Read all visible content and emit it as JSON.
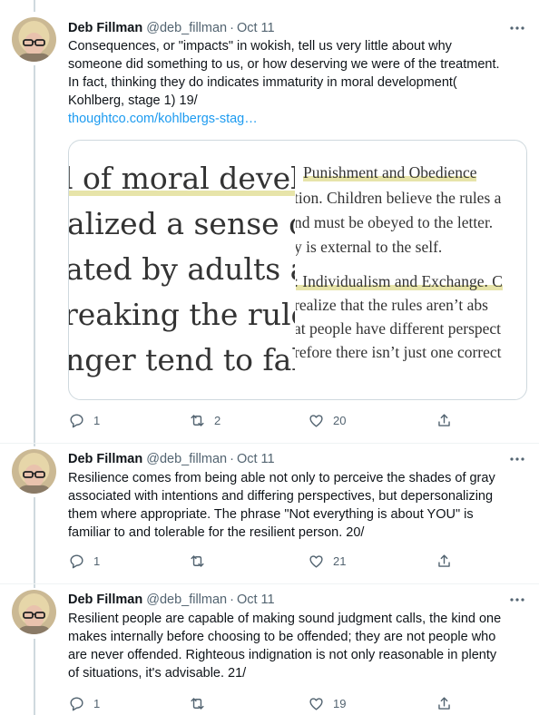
{
  "tweets": [
    {
      "author": {
        "name": "Deb Fillman",
        "handle": "@deb_fillman",
        "time": "Oct 11"
      },
      "lines": [
        "Consequences, or \"impacts\" in wokish, tell us very little about why",
        "someone did something to us, or how deserving we were of the treatment.",
        "In fact, thinking they do indicates immaturity in moral development(",
        "Kohlberg, stage 1) 19/"
      ],
      "link": "thoughtco.com/kohlbergs-stag…",
      "media": {
        "left_lines": [
          "l of moral develop",
          "alized a sense of ri",
          "ated by adults an",
          "reaking the rules",
          "nger tend to fall ir"
        ],
        "right_lines": [
          "Punishment and Obedience",
          "tion. Children believe the rules a",
          "nd must be obeyed to the letter.",
          "y is external to the self.",
          ": Individualism and Exchange. C",
          "realize that the rules aren’t abs",
          "at people have different perspect",
          "refore there isn’t just one correct"
        ]
      },
      "actions": {
        "replies": "1",
        "retweets": "2",
        "likes": "20"
      }
    },
    {
      "author": {
        "name": "Deb Fillman",
        "handle": "@deb_fillman",
        "time": "Oct 11"
      },
      "lines": [
        "Resilience comes from being able not only to perceive the shades of gray",
        "associated with intentions and differing perspectives, but depersonalizing",
        "them where appropriate. The phrase \"Not everything is about YOU\" is",
        "familiar to and tolerable for the resilient person. 20/"
      ],
      "actions": {
        "replies": "1",
        "retweets": "",
        "likes": "21"
      }
    },
    {
      "author": {
        "name": "Deb Fillman",
        "handle": "@deb_fillman",
        "time": "Oct 11"
      },
      "lines": [
        "Resilient people are capable of making sound judgment calls, the kind one",
        "makes internally before choosing to be offended; they are not people who",
        "are never offended. Righteous indignation is not only reasonable in plenty",
        "of situations, it's advisable. 21/"
      ],
      "actions": {
        "replies": "1",
        "retweets": "",
        "likes": "19"
      }
    }
  ],
  "colors": {
    "text": "#0f1419",
    "secondary": "#536471",
    "link": "#1d9bf0",
    "thread_line": "#cfd9de",
    "highlight": "#e7e4a9"
  },
  "icons": [
    "more-icon",
    "reply-icon",
    "retweet-icon",
    "like-icon",
    "share-icon"
  ]
}
